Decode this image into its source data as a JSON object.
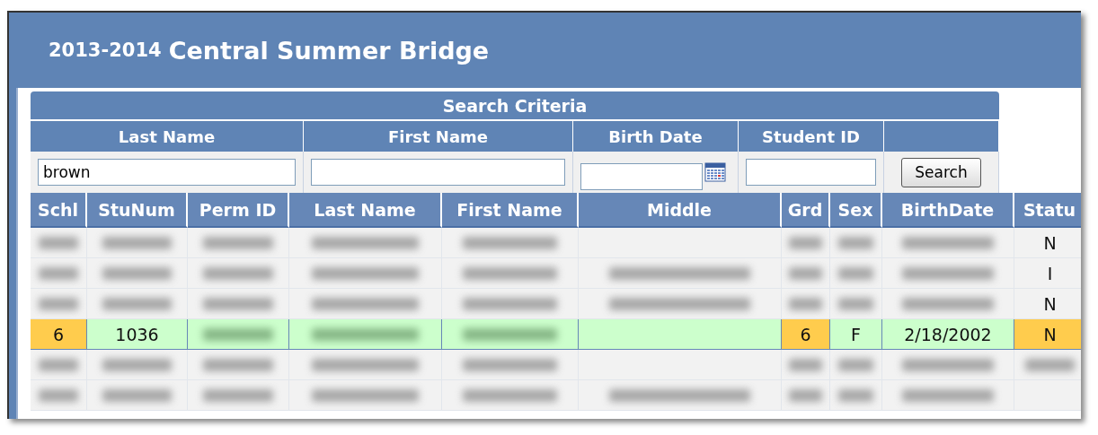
{
  "title": {
    "year": "2013-2014",
    "name": "Central Summer Bridge"
  },
  "search": {
    "heading": "Search Criteria",
    "fields": [
      {
        "label": "Last Name",
        "value": "brown",
        "kind": "text"
      },
      {
        "label": "First Name",
        "kind": "text"
      },
      {
        "label": "Birth Date",
        "kind": "date"
      },
      {
        "label": "Student ID",
        "kind": "text"
      }
    ],
    "button": "Search"
  },
  "table": {
    "columns": [
      "Schl",
      "StuNum",
      "Perm ID",
      "Last Name",
      "First Name",
      "Middle",
      "Grd",
      "Sex",
      "BirthDate",
      "Statu"
    ],
    "rows": [
      {
        "selected": false,
        "cells": [
          {
            "kind": "blurred",
            "highlight": false
          },
          {
            "kind": "blurred",
            "highlight": false
          },
          {
            "kind": "blurred",
            "highlight": false
          },
          {
            "kind": "blurred",
            "highlight": false
          },
          {
            "kind": "blurred",
            "highlight": false
          },
          {
            "kind": "empty",
            "highlight": false
          },
          {
            "kind": "blurred",
            "highlight": false
          },
          {
            "kind": "blurred",
            "highlight": false
          },
          {
            "kind": "blurred",
            "highlight": false
          },
          {
            "kind": "text",
            "text": "N",
            "highlight": false
          }
        ]
      },
      {
        "selected": false,
        "cells": [
          {
            "kind": "blurred",
            "highlight": false
          },
          {
            "kind": "blurred",
            "highlight": false
          },
          {
            "kind": "blurred",
            "highlight": false
          },
          {
            "kind": "blurred",
            "highlight": false
          },
          {
            "kind": "blurred",
            "highlight": false
          },
          {
            "kind": "blurred",
            "highlight": false
          },
          {
            "kind": "blurred",
            "highlight": false
          },
          {
            "kind": "blurred",
            "highlight": false
          },
          {
            "kind": "blurred",
            "highlight": false
          },
          {
            "kind": "text",
            "text": "I",
            "highlight": false
          }
        ]
      },
      {
        "selected": false,
        "cells": [
          {
            "kind": "blurred",
            "highlight": false
          },
          {
            "kind": "blurred",
            "highlight": false
          },
          {
            "kind": "blurred",
            "highlight": false
          },
          {
            "kind": "blurred",
            "highlight": false
          },
          {
            "kind": "blurred",
            "highlight": false
          },
          {
            "kind": "blurred",
            "highlight": false
          },
          {
            "kind": "blurred",
            "highlight": false
          },
          {
            "kind": "blurred",
            "highlight": false
          },
          {
            "kind": "blurred",
            "highlight": false
          },
          {
            "kind": "text",
            "text": "N",
            "highlight": false
          }
        ]
      },
      {
        "selected": true,
        "cells": [
          {
            "kind": "text",
            "text": "6",
            "highlight": true
          },
          {
            "kind": "text",
            "text": "1036",
            "highlight": false
          },
          {
            "kind": "blurred",
            "highlight": false
          },
          {
            "kind": "blurred",
            "highlight": false
          },
          {
            "kind": "blurred",
            "highlight": false
          },
          {
            "kind": "empty",
            "highlight": false
          },
          {
            "kind": "text",
            "text": "6",
            "highlight": true
          },
          {
            "kind": "text",
            "text": "F",
            "highlight": false
          },
          {
            "kind": "text",
            "text": "2/18/2002",
            "highlight": false
          },
          {
            "kind": "text",
            "text": "N",
            "highlight": true
          }
        ]
      },
      {
        "selected": false,
        "cells": [
          {
            "kind": "blurred",
            "highlight": false
          },
          {
            "kind": "blurred",
            "highlight": false
          },
          {
            "kind": "blurred",
            "highlight": false
          },
          {
            "kind": "blurred",
            "highlight": false
          },
          {
            "kind": "blurred",
            "highlight": false
          },
          {
            "kind": "empty",
            "highlight": false
          },
          {
            "kind": "blurred",
            "highlight": false
          },
          {
            "kind": "blurred",
            "highlight": false
          },
          {
            "kind": "blurred",
            "highlight": false
          },
          {
            "kind": "blurred",
            "highlight": false
          }
        ]
      },
      {
        "selected": false,
        "cells": [
          {
            "kind": "blurred",
            "highlight": false
          },
          {
            "kind": "blurred",
            "highlight": false
          },
          {
            "kind": "blurred",
            "highlight": false
          },
          {
            "kind": "blurred",
            "highlight": false
          },
          {
            "kind": "blurred",
            "highlight": false
          },
          {
            "kind": "blurred",
            "highlight": false
          },
          {
            "kind": "blurred",
            "highlight": false
          },
          {
            "kind": "blurred",
            "highlight": false
          },
          {
            "kind": "blurred",
            "highlight": false
          },
          {
            "kind": "empty",
            "highlight": false
          }
        ]
      }
    ]
  }
}
